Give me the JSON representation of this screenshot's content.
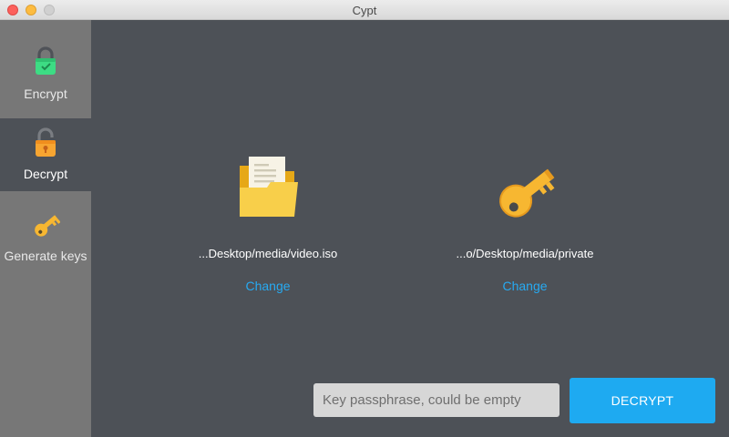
{
  "window": {
    "title": "Cypt"
  },
  "sidebar": {
    "items": [
      {
        "label": "Encrypt",
        "icon": "lock-closed-green-icon",
        "active": false
      },
      {
        "label": "Decrypt",
        "icon": "lock-open-orange-icon",
        "active": true
      },
      {
        "label": "Generate keys",
        "icon": "key-icon",
        "active": false
      }
    ]
  },
  "main": {
    "file": {
      "icon": "folder-document-icon",
      "path": "...Desktop/media/video.iso",
      "change_label": "Change"
    },
    "key": {
      "icon": "key-icon",
      "path": "...o/Desktop/media/private",
      "change_label": "Change"
    },
    "passphrase": {
      "value": "",
      "placeholder": "Key passphrase, could be empty"
    },
    "decrypt_label": "DECRYPT"
  },
  "colors": {
    "sidebar_bg": "#777777",
    "active_bg": "#4d5157",
    "accent": "#1eaaf1",
    "link": "#27aaf2"
  }
}
